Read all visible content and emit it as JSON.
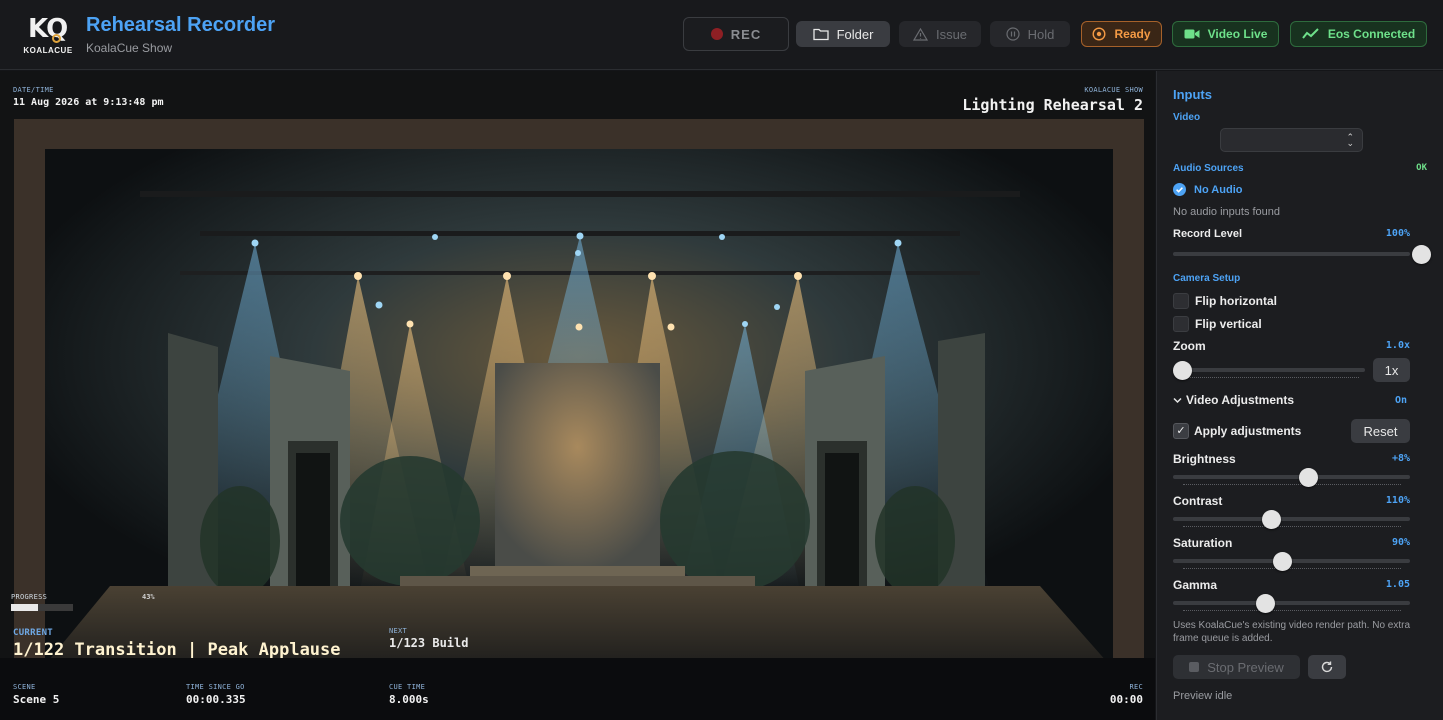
{
  "header": {
    "logo_text": "KQ",
    "logo_word": "KOALACUE",
    "title": "Rehearsal Recorder",
    "subtitle": "KoalaCue Show",
    "buttons": {
      "rec": "REC",
      "folder": "Folder",
      "issue": "Issue",
      "hold": "Hold",
      "ready": "Ready",
      "video_live": "Video Live",
      "eos": "Eos Connected"
    }
  },
  "overlay": {
    "datetime_label": "DATE/TIME",
    "datetime_value": "11 Aug 2026 at 9:13:48 pm",
    "show_label": "KOALACUE SHOW",
    "show_value": "Lighting Rehearsal 2",
    "progress_label": "PROGRESS",
    "progress_text": "43%",
    "progress_fraction": 0.43,
    "current_label": "CURRENT",
    "current_value": "1/122 Transition | Peak Applause",
    "next_label": "NEXT",
    "next_value": "1/123 Build",
    "scene_label": "SCENE",
    "scene_value": "Scene 5",
    "tsg_label": "TIME SINCE GO",
    "tsg_value": "00:00.335",
    "cue_label": "CUE TIME",
    "cue_value": "8.000s",
    "rec_label": "REC",
    "rec_value": "00:00"
  },
  "sidebar": {
    "inputs_title": "Inputs",
    "video_label": "Video",
    "video_selected": "",
    "audio_sources_label": "Audio Sources",
    "audio_status": "OK",
    "no_audio_label": "No Audio",
    "no_audio_msg": "No audio inputs found",
    "record_level_label": "Record Level",
    "record_level_text": "100%",
    "record_level_fraction": 1.0,
    "camera_setup_label": "Camera Setup",
    "flip_h_label": "Flip horizontal",
    "flip_v_label": "Flip vertical",
    "zoom_label": "Zoom",
    "zoom_text": "1.0x",
    "zoom_fraction": 0.0,
    "zoom_button": "1x",
    "video_adj_label": "Video Adjustments",
    "video_adj_status": "On",
    "apply_adj_label": "Apply adjustments",
    "reset_label": "Reset",
    "brightness_label": "Brightness",
    "brightness_text": "+8%",
    "brightness_fraction": 0.58,
    "contrast_label": "Contrast",
    "contrast_text": "110%",
    "contrast_fraction": 0.41,
    "saturation_label": "Saturation",
    "saturation_text": "90%",
    "saturation_fraction": 0.46,
    "gamma_label": "Gamma",
    "gamma_text": "1.05",
    "gamma_fraction": 0.38,
    "render_note": "Uses KoalaCue's existing video render path. No extra frame queue is added.",
    "stop_preview_label": "Stop Preview",
    "preview_status": "Preview idle"
  },
  "colors": {
    "accent_blue": "#4da3f5",
    "ready_orange": "#f49a45",
    "live_green": "#6ee08a",
    "rec_red": "#8e1f24"
  },
  "icons": {
    "folder": "folder-icon",
    "issue": "warning-triangle-icon",
    "hold": "pause-circle-icon",
    "ready": "record-circle-icon",
    "video": "video-camera-icon",
    "eos": "activity-wave-icon",
    "refresh": "refresh-icon",
    "stop": "stop-square-icon",
    "check": "check-circle-icon"
  }
}
